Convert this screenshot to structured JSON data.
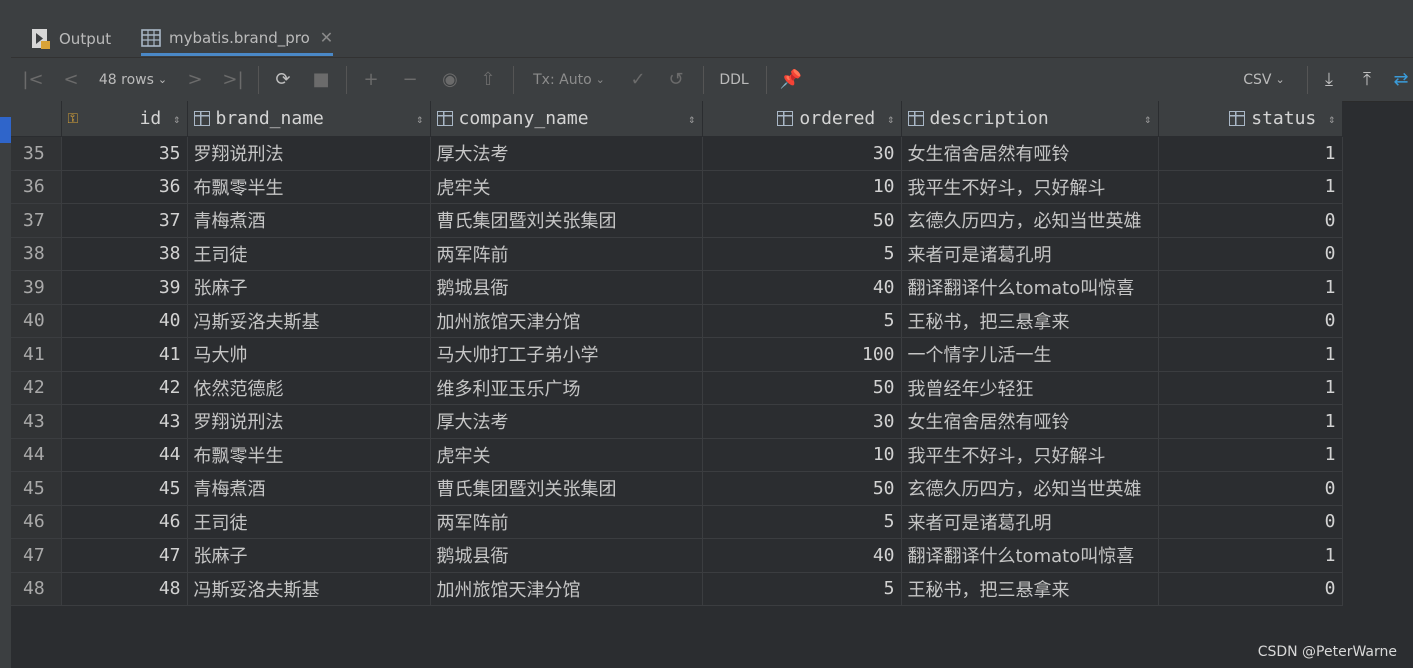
{
  "tabs": [
    {
      "label": "Output",
      "icon": "output-icon"
    },
    {
      "label": "mybatis.brand_pro",
      "icon": "table-icon"
    }
  ],
  "toolbar": {
    "rows_label": "48 rows",
    "tx_label": "Tx: Auto",
    "ddl_label": "DDL",
    "export_format": "CSV"
  },
  "columns": [
    {
      "name": "id",
      "align": "right"
    },
    {
      "name": "brand_name",
      "align": "left"
    },
    {
      "name": "company_name",
      "align": "left"
    },
    {
      "name": "ordered",
      "align": "right"
    },
    {
      "name": "description",
      "align": "left"
    },
    {
      "name": "status",
      "align": "right"
    }
  ],
  "rows": [
    [
      "35",
      "35",
      "罗翔说刑法",
      "厚大法考",
      "30",
      "女生宿舍居然有哑铃",
      "1"
    ],
    [
      "36",
      "36",
      "布飘零半生",
      "虎牢关",
      "10",
      "我平生不好斗，只好解斗",
      "1"
    ],
    [
      "37",
      "37",
      "青梅煮酒",
      "曹氏集团暨刘关张集团",
      "50",
      "玄德久历四方，必知当世英雄",
      "0"
    ],
    [
      "38",
      "38",
      "王司徒",
      "两军阵前",
      "5",
      "来者可是诸葛孔明",
      "0"
    ],
    [
      "39",
      "39",
      "张麻子",
      "鹅城县衙",
      "40",
      "翻译翻译什么tomato叫惊喜",
      "1"
    ],
    [
      "40",
      "40",
      "冯斯妥洛夫斯基",
      "加州旅馆天津分馆",
      "5",
      "王秘书，把三悬拿来",
      "0"
    ],
    [
      "41",
      "41",
      "马大帅",
      "马大帅打工子弟小学",
      "100",
      "一个情字儿活一生",
      "1"
    ],
    [
      "42",
      "42",
      "依然范德彪",
      "维多利亚玉乐广场",
      "50",
      "我曾经年少轻狂",
      "1"
    ],
    [
      "43",
      "43",
      "罗翔说刑法",
      "厚大法考",
      "30",
      "女生宿舍居然有哑铃",
      "1"
    ],
    [
      "44",
      "44",
      "布飘零半生",
      "虎牢关",
      "10",
      "我平生不好斗，只好解斗",
      "1"
    ],
    [
      "45",
      "45",
      "青梅煮酒",
      "曹氏集团暨刘关张集团",
      "50",
      "玄德久历四方，必知当世英雄",
      "0"
    ],
    [
      "46",
      "46",
      "王司徒",
      "两军阵前",
      "5",
      "来者可是诸葛孔明",
      "0"
    ],
    [
      "47",
      "47",
      "张麻子",
      "鹅城县衙",
      "40",
      "翻译翻译什么tomato叫惊喜",
      "1"
    ],
    [
      "48",
      "48",
      "冯斯妥洛夫斯基",
      "加州旅馆天津分馆",
      "5",
      "王秘书，把三悬拿来",
      "0"
    ]
  ],
  "watermark": "CSDN @PeterWarne",
  "colors": {
    "background": "#2b2d30",
    "panel": "#3c3f41",
    "accent": "#4a88c7"
  }
}
